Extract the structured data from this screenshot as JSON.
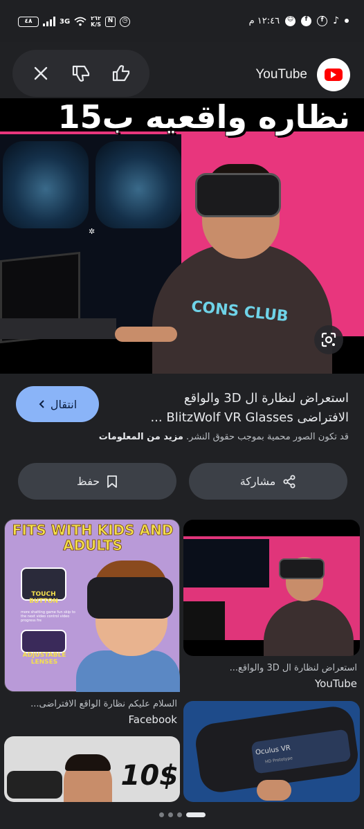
{
  "status_bar": {
    "time": "١٢:٤٦ م",
    "battery": "٤٨",
    "net_speed_value": "٢٦٢",
    "net_speed_unit": "K/S",
    "network": "3G"
  },
  "source": {
    "name": "YouTube"
  },
  "hero": {
    "overlay_title": "نظاره واقعيه ب15",
    "shirt_text": "CONS CLUB"
  },
  "result": {
    "title_line1": "استعراض لنظارة ال 3D والواقع",
    "title_line2": "الافتراضى BlitzWolf VR Glasses ...",
    "visit_label": "انتقال",
    "copyright_text": "قد تكون الصور محمية بموجب حقوق النشر. ",
    "more_info_label": "مزيد من المعلومات",
    "share_label": "مشاركة",
    "save_label": "حفظ"
  },
  "related": [
    {
      "title": "استعراض لنظارة ال 3D والواقع...",
      "source": "YouTube"
    },
    {
      "title": "السلام عليكم نظارة الواقع الافتراضى...",
      "source": "Facebook",
      "image_text_title": "FITS WITH KIDS AND ADULTS",
      "image_text_touch": "TOUCH BUTTON",
      "image_text_touch_desc": "more shatting game fun skip to the next video control video progress fre",
      "image_text_lenses": "ADJUSTABLE LENSES"
    },
    {
      "image_text": "10$"
    },
    {
      "image_text": "Oculus VR",
      "image_subtext": "HD Prototype"
    }
  ],
  "colors": {
    "accent_button": "#8ab4f8",
    "youtube_red": "#ff0000",
    "hero_pink": "#e8367d",
    "background": "#202124"
  },
  "icons": {
    "close": "close-icon",
    "thumb_down": "thumb-down-icon",
    "thumb_up": "thumb-up-icon",
    "lens": "google-lens-icon",
    "share": "share-icon",
    "bookmark": "bookmark-icon",
    "chevron": "chevron-left-icon"
  }
}
